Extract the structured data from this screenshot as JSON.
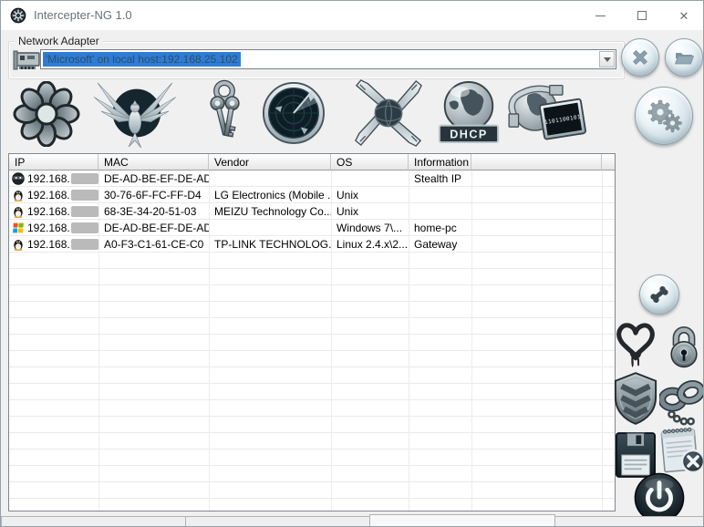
{
  "window": {
    "title": "Intercepter-NG 1.0"
  },
  "adapter": {
    "group_label": "Network Adapter",
    "selected_value": "'Microsoft' on local host:192.168.25.102"
  },
  "toolbar": {
    "dhcp_label": "DHCP",
    "raw_binary": "1101100101",
    "mode_icons": [
      "messenger-mode",
      "resurrection-mode",
      "password-mode",
      "scan-mode",
      "mitm-mode",
      "dhcp-mode",
      "raw-mode"
    ],
    "action_icons": [
      "stop-x",
      "open-folder",
      "settings-gears"
    ]
  },
  "side_icons": [
    "nat-bone",
    "heartbleed-heart",
    "ssl-lock",
    "shield",
    "cuffs",
    "save-floppy",
    "clear-log",
    "power"
  ],
  "table": {
    "columns": [
      "IP",
      "MAC",
      "Vendor",
      "OS",
      "Information"
    ],
    "rows": [
      {
        "os_icon": "stealth-ninja",
        "ip_prefix": "192.168.",
        "ip_suffix_redacted": true,
        "mac": "DE-AD-BE-EF-DE-AD",
        "vendor": "",
        "os": "",
        "info": "Stealth IP"
      },
      {
        "os_icon": "linux-tux",
        "ip_prefix": "192.168.",
        "ip_suffix_redacted": true,
        "mac": "30-76-6F-FC-FF-D4",
        "vendor": "LG Electronics (Mobile ...",
        "os": "Unix",
        "info": ""
      },
      {
        "os_icon": "linux-tux",
        "ip_prefix": "192.168.",
        "ip_suffix_redacted": true,
        "mac": "68-3E-34-20-51-03",
        "vendor": "MEIZU Technology Co....",
        "os": "Unix",
        "info": ""
      },
      {
        "os_icon": "windows-logo",
        "ip_prefix": "192.168.",
        "ip_suffix_redacted": true,
        "mac": "DE-AD-BE-EF-DE-AD",
        "vendor": "",
        "os": "Windows 7\\...",
        "info": "home-pc"
      },
      {
        "os_icon": "linux-tux",
        "ip_prefix": "192.168.",
        "ip_suffix_redacted": true,
        "mac": "A0-F3-C1-61-CE-C0",
        "vendor": "TP-LINK TECHNOLOG...",
        "os": "Linux 2.4.x\\2...",
        "info": "Gateway"
      }
    ]
  },
  "colors": {
    "selection_blue": "#2e7cd8",
    "window_bg": "#f0f0f0",
    "titlebar_bg": "#ffffff"
  }
}
